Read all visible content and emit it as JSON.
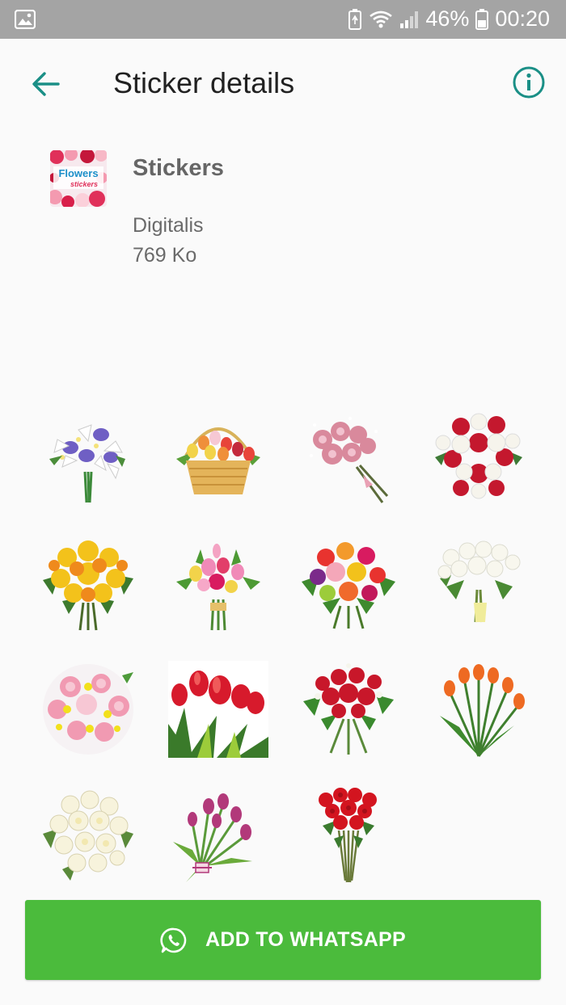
{
  "status_bar": {
    "battery": "46%",
    "time": "00:20"
  },
  "app_bar": {
    "title": "Sticker details"
  },
  "pack": {
    "name": "Stickers",
    "publisher": "Digitalis",
    "size": "769 Ko",
    "thumb_text_top": "Flowers",
    "thumb_text_bottom": "stickers"
  },
  "stickers": [
    "lily-iris-bouquet",
    "tulip-basket",
    "pink-rose-bouquet",
    "red-white-rose-bouquet",
    "yellow-orange-bouquet",
    "mixed-spring-bouquet",
    "colorful-mixed-bouquet",
    "white-rose-bouquet",
    "pink-chrysanthemum-bouquet",
    "red-tulips-closeup",
    "red-carnation-bouquet",
    "orange-tulips",
    "white-rose-round-bouquet",
    "purple-tulip-bouquet",
    "red-rose-bouquet"
  ],
  "add_button": {
    "label": "ADD TO WHATSAPP"
  },
  "colors": {
    "status_bar": "#a4a4a4",
    "accent": "#1a8f86",
    "button": "#4bbb3c"
  }
}
